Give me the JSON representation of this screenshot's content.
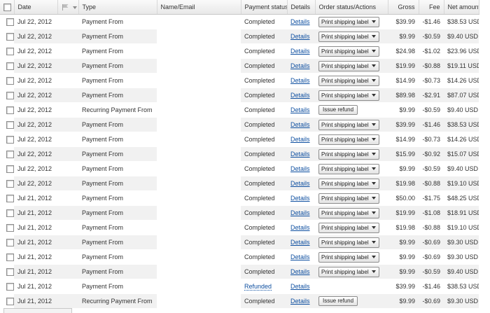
{
  "headers": {
    "date": "Date",
    "type": "Type",
    "name_email": "Name/Email",
    "payment_status": "Payment status",
    "details": "Details",
    "order_status": "Order status/Actions",
    "gross": "Gross",
    "fee": "Fee",
    "net": "Net amount"
  },
  "labels": {
    "details_link": "Details",
    "print_label": "Print shipping label",
    "issue_refund": "Issue refund"
  },
  "rows": [
    {
      "date": "Jul 22, 2012",
      "type": "Payment From",
      "status": "Completed",
      "action": "print",
      "gross": "$39.99",
      "fee": "-$1.46",
      "net": "$38.53 USD"
    },
    {
      "date": "Jul 22, 2012",
      "type": "Payment From",
      "status": "Completed",
      "action": "print",
      "gross": "$9.99",
      "fee": "-$0.59",
      "net": "$9.40 USD"
    },
    {
      "date": "Jul 22, 2012",
      "type": "Payment From",
      "status": "Completed",
      "action": "print",
      "gross": "$24.98",
      "fee": "-$1.02",
      "net": "$23.96 USD"
    },
    {
      "date": "Jul 22, 2012",
      "type": "Payment From",
      "status": "Completed",
      "action": "print",
      "gross": "$19.99",
      "fee": "-$0.88",
      "net": "$19.11 USD"
    },
    {
      "date": "Jul 22, 2012",
      "type": "Payment From",
      "status": "Completed",
      "action": "print",
      "gross": "$14.99",
      "fee": "-$0.73",
      "net": "$14.26 USD"
    },
    {
      "date": "Jul 22, 2012",
      "type": "Payment From",
      "status": "Completed",
      "action": "print",
      "gross": "$89.98",
      "fee": "-$2.91",
      "net": "$87.07 USD"
    },
    {
      "date": "Jul 22, 2012",
      "type": "Recurring Payment From",
      "status": "Completed",
      "action": "refund",
      "gross": "$9.99",
      "fee": "-$0.59",
      "net": "$9.40 USD"
    },
    {
      "date": "Jul 22, 2012",
      "type": "Payment From",
      "status": "Completed",
      "action": "print",
      "gross": "$39.99",
      "fee": "-$1.46",
      "net": "$38.53 USD"
    },
    {
      "date": "Jul 22, 2012",
      "type": "Payment From",
      "status": "Completed",
      "action": "print",
      "gross": "$14.99",
      "fee": "-$0.73",
      "net": "$14.26 USD"
    },
    {
      "date": "Jul 22, 2012",
      "type": "Payment From",
      "status": "Completed",
      "action": "print",
      "gross": "$15.99",
      "fee": "-$0.92",
      "net": "$15.07 USD"
    },
    {
      "date": "Jul 22, 2012",
      "type": "Payment From",
      "status": "Completed",
      "action": "print",
      "gross": "$9.99",
      "fee": "-$0.59",
      "net": "$9.40 USD"
    },
    {
      "date": "Jul 22, 2012",
      "type": "Payment From",
      "status": "Completed",
      "action": "print",
      "gross": "$19.98",
      "fee": "-$0.88",
      "net": "$19.10 USD"
    },
    {
      "date": "Jul 21, 2012",
      "type": "Payment From",
      "status": "Completed",
      "action": "print",
      "gross": "$50.00",
      "fee": "-$1.75",
      "net": "$48.25 USD"
    },
    {
      "date": "Jul 21, 2012",
      "type": "Payment From",
      "status": "Completed",
      "action": "print",
      "gross": "$19.99",
      "fee": "-$1.08",
      "net": "$18.91 USD"
    },
    {
      "date": "Jul 21, 2012",
      "type": "Payment From",
      "status": "Completed",
      "action": "print",
      "gross": "$19.98",
      "fee": "-$0.88",
      "net": "$19.10 USD"
    },
    {
      "date": "Jul 21, 2012",
      "type": "Payment From",
      "status": "Completed",
      "action": "print",
      "gross": "$9.99",
      "fee": "-$0.69",
      "net": "$9.30 USD"
    },
    {
      "date": "Jul 21, 2012",
      "type": "Payment From",
      "status": "Completed",
      "action": "print",
      "gross": "$9.99",
      "fee": "-$0.69",
      "net": "$9.30 USD"
    },
    {
      "date": "Jul 21, 2012",
      "type": "Payment From",
      "status": "Completed",
      "action": "print",
      "gross": "$9.99",
      "fee": "-$0.59",
      "net": "$9.40 USD"
    },
    {
      "date": "Jul 21, 2012",
      "type": "Payment From",
      "status": "Refunded",
      "action": "none",
      "gross": "$39.99",
      "fee": "-$1.46",
      "net": "$38.53 USD"
    },
    {
      "date": "Jul 21, 2012",
      "type": "Recurring Payment From",
      "status": "Completed",
      "action": "refund",
      "gross": "$9.99",
      "fee": "-$0.69",
      "net": "$9.30 USD"
    }
  ]
}
